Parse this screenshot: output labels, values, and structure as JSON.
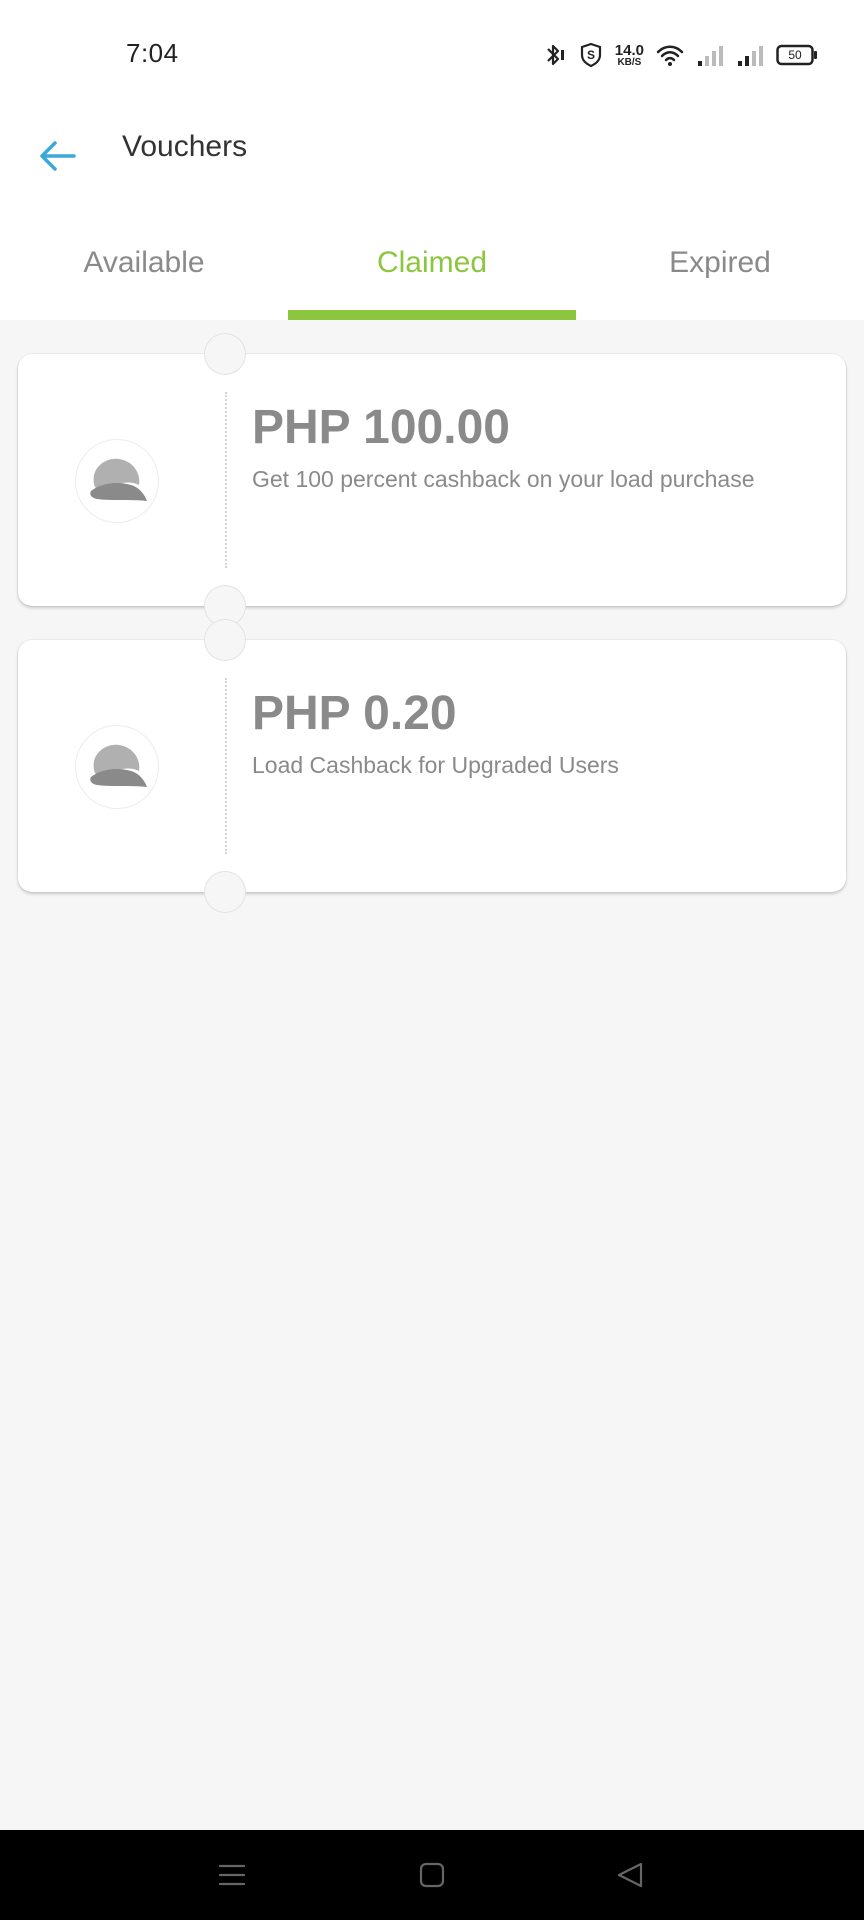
{
  "status_bar": {
    "time": "7:04",
    "net_speed_value": "14.0",
    "net_speed_unit": "KB/S",
    "battery_level": "50"
  },
  "header": {
    "title": "Vouchers",
    "back_icon": "arrow-left-icon",
    "back_color": "#3aa8d8"
  },
  "tabs": [
    {
      "label": "Available",
      "active": false
    },
    {
      "label": "Claimed",
      "active": true
    },
    {
      "label": "Expired",
      "active": false
    }
  ],
  "accent_color": "#8cc63e",
  "vouchers": [
    {
      "amount": "PHP 100.00",
      "description": "Get 100 percent cashback on your load purchase",
      "icon": "brand-logo-icon"
    },
    {
      "amount": "PHP 0.20",
      "description": "Load Cashback for Upgraded Users",
      "icon": "brand-logo-icon"
    }
  ],
  "nav": {
    "menu_icon": "menu-icon",
    "home_icon": "home-square-icon",
    "back_icon": "back-triangle-icon"
  }
}
